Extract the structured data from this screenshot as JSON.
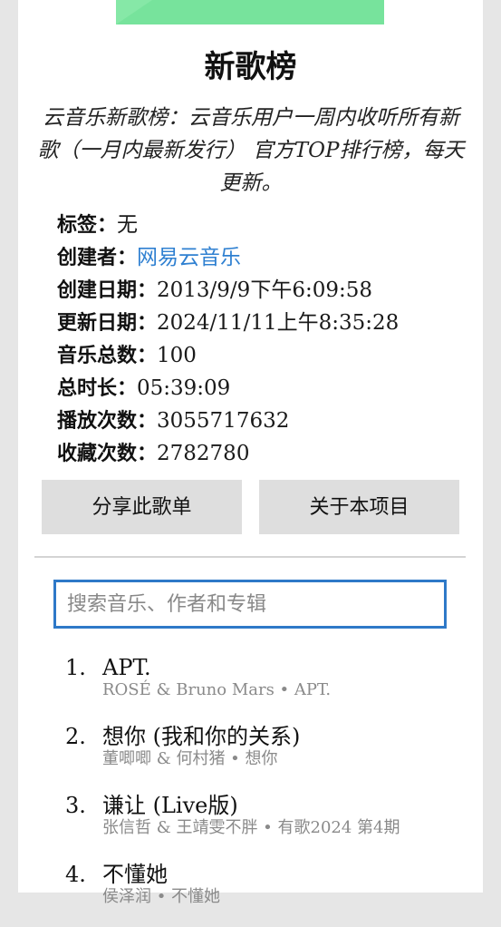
{
  "playlist": {
    "title": "新歌榜",
    "description": "云音乐新歌榜：云音乐用户一周内收听所有新歌（一月内最新发行） 官方TOP排行榜，每天更新。",
    "meta": [
      {
        "key": "标签：",
        "value": "无"
      },
      {
        "key": "创建者：",
        "value": "网易云音乐"
      },
      {
        "key": "创建日期：",
        "value": "2013/9/9下午6:09:58"
      },
      {
        "key": "更新日期：",
        "value": "2024/11/11上午8:35:28"
      },
      {
        "key": "音乐总数：",
        "value": "100"
      },
      {
        "key": "总时长：",
        "value": "05:39:09"
      },
      {
        "key": "播放次数：",
        "value": "3055717632"
      },
      {
        "key": "收藏次数：",
        "value": "2782780"
      }
    ]
  },
  "buttons": {
    "share_label": "分享此歌单",
    "about_label": "关于本项目"
  },
  "search": {
    "placeholder": "搜索音乐、作者和专辑",
    "value": ""
  },
  "tracks": [
    {
      "index": "1.",
      "name": "APT.",
      "sub": "ROSÉ & Bruno Mars • APT."
    },
    {
      "index": "2.",
      "name": "想你 (我和你的关系)",
      "sub": "董唧唧 & 何村猪 • 想你"
    },
    {
      "index": "3.",
      "name": "谦让 (Live版)",
      "sub": "张信哲 & 王靖雯不胖 • 有歌2024 第4期"
    },
    {
      "index": "4.",
      "name": "不懂她",
      "sub": "侯泽润 • 不懂她"
    }
  ],
  "colors": {
    "accent": "#2e79c8",
    "link": "#2f80d1",
    "cover": "#77e39c",
    "button_bg": "#dedede"
  }
}
